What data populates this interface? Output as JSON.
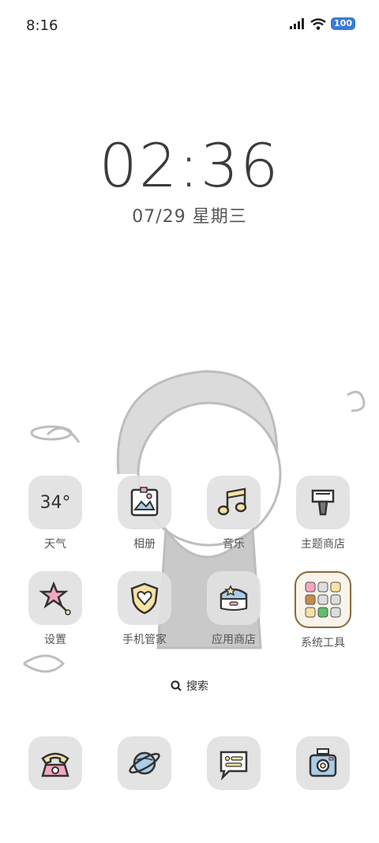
{
  "status_bar": {
    "time": "8:16",
    "battery": "100"
  },
  "lock_clock": {
    "time": "02:36",
    "date": "07/29 星期三"
  },
  "apps": {
    "weather": {
      "label": "天气",
      "temp": "34°"
    },
    "gallery": {
      "label": "相册"
    },
    "music": {
      "label": "音乐"
    },
    "themes": {
      "label": "主题商店"
    },
    "settings": {
      "label": "设置"
    },
    "security": {
      "label": "手机管家"
    },
    "app_store": {
      "label": "应用商店"
    },
    "system_tools": {
      "label": "系统工具"
    }
  },
  "search": {
    "label": "搜索"
  },
  "dock": [
    "phone",
    "browser",
    "messages",
    "camera"
  ],
  "colors": {
    "tile": "#e1e1e1",
    "pink": "#f4a7c0",
    "yellow": "#f7e3a1",
    "blue": "#a9cde8"
  }
}
